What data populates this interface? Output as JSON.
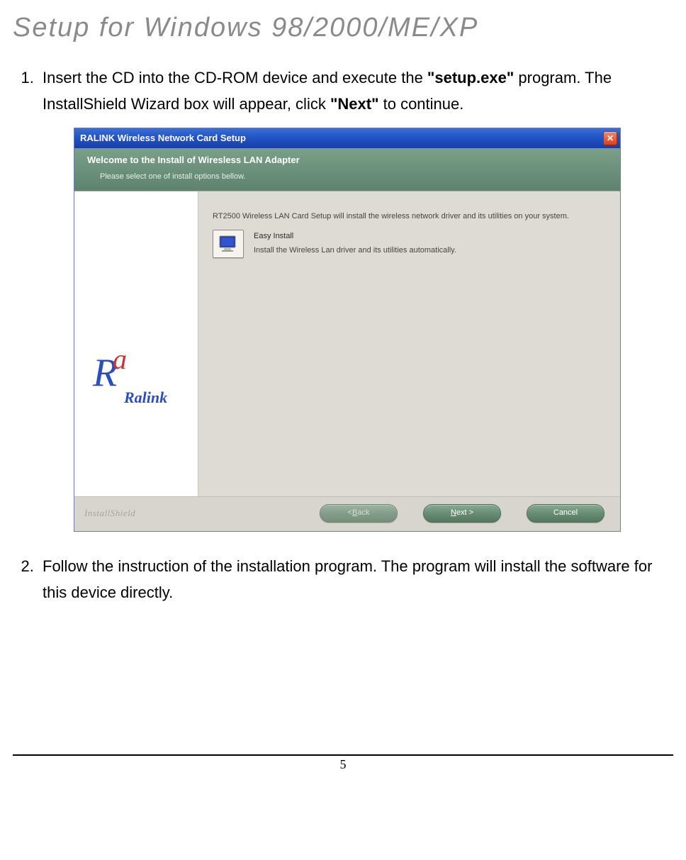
{
  "heading": "Setup for Windows 98/2000/ME/XP",
  "steps": {
    "s1_a": "Insert the CD into the CD-ROM device and execute the ",
    "s1_bold1": "\"setup.exe\"",
    "s1_b": " program. The InstallShield Wizard box will appear, click ",
    "s1_bold2": "\"Next\"",
    "s1_c": " to continue.",
    "s2": "Follow the instruction of the installation program. The program will install the software for this device directly."
  },
  "installer": {
    "title": "RALINK Wireless Network Card Setup",
    "subheader_title": "Welcome to the Install of Wiresless LAN Adapter",
    "subheader_sub": "Please select one of install options bellow.",
    "desc": "RT2500 Wireless LAN Card Setup will install the wireless network driver and its utilities on your system.",
    "easy_title": "Easy Install",
    "easy_sub": "Install the Wireless Lan driver and its utilities automatically.",
    "brand": "Ralink",
    "back_label_pre": "< ",
    "back_label_u": "B",
    "back_label_post": "ack",
    "next_label_u": "N",
    "next_label_post": "ext >",
    "cancel_label": "Cancel",
    "installshield": "InstallShield"
  },
  "page_number": "5"
}
